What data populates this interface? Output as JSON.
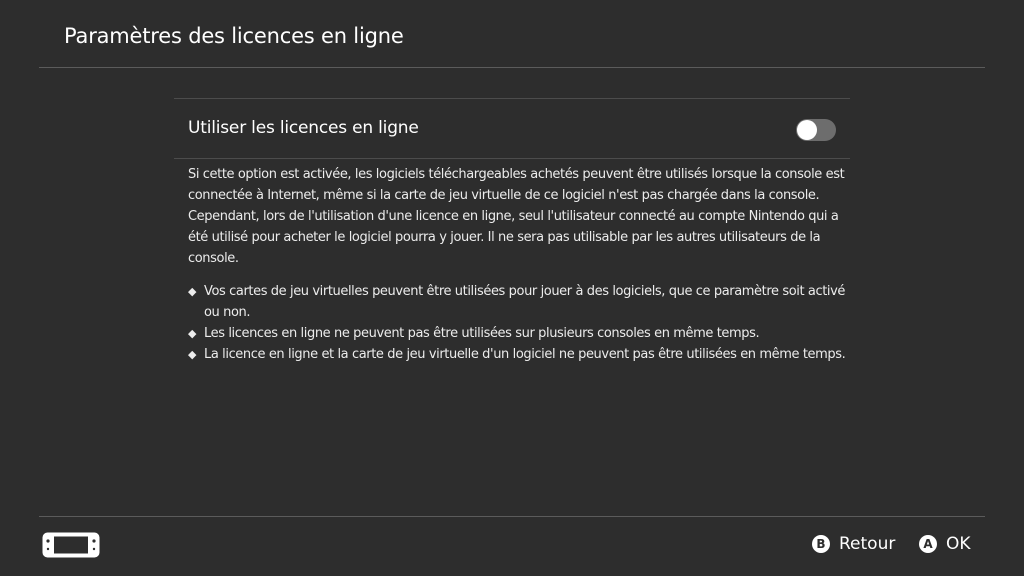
{
  "header": {
    "title": "Paramètres des licences en ligne"
  },
  "option": {
    "label": "Utiliser les licences en ligne",
    "enabled": false
  },
  "description": "Si cette option est activée, les logiciels téléchargeables achetés peuvent être utilisés lorsque la console est connectée à Internet, même si la carte de jeu virtuelle de ce logiciel n'est pas chargée dans la console. Cependant, lors de l'utilisation d'une licence en ligne, seul l'utilisateur connecté au compte Nintendo qui a été utilisé pour acheter le logiciel pourra y jouer. Il ne sera pas utilisable par les autres utilisateurs de la console.",
  "bullets": {
    "marker": "◆",
    "items": [
      "Vos cartes de jeu virtuelles peuvent être utilisées pour jouer à des logiciels, que ce paramètre soit activé ou non.",
      "Les licences en ligne ne peuvent pas être utilisées sur plusieurs consoles en même temps.",
      "La licence en ligne et la carte de jeu virtuelle d'un logiciel ne peuvent pas être utilisées en même temps."
    ]
  },
  "footer": {
    "console_icon": "handheld-console-icon",
    "back": {
      "key": "B",
      "label": "Retour"
    },
    "ok": {
      "key": "A",
      "label": "OK"
    }
  },
  "colors": {
    "background": "#2d2d2d",
    "divider": "#5b5b5b",
    "toggle_off": "#6d6d6d",
    "text": "#ffffff"
  }
}
